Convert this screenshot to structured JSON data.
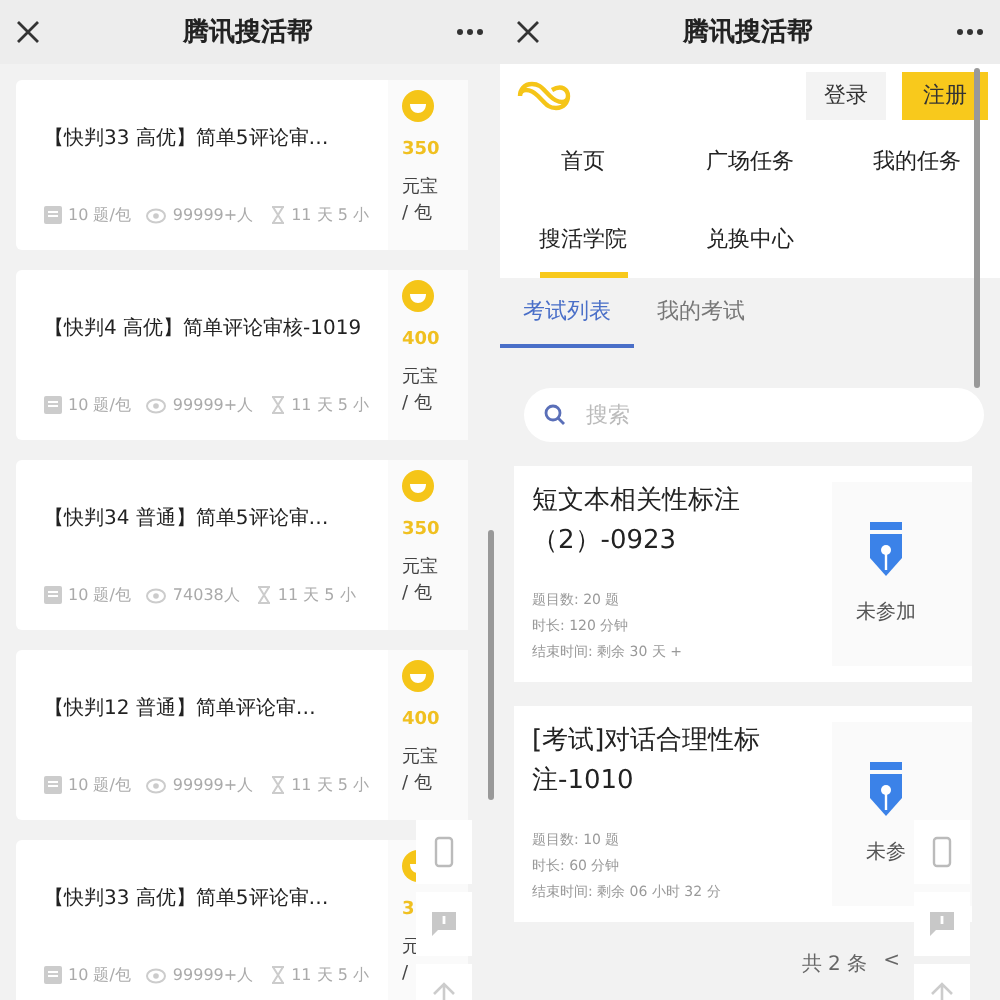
{
  "left_screen": {
    "title": "腾讯搜活帮",
    "tasks": [
      {
        "title": "【快判33 高优】简单5评论审…",
        "questions": "10 题/包",
        "participants": "99999+人",
        "time": "11 天 5 小",
        "amount": "350",
        "unit": [
          "元宝",
          "/ 包"
        ]
      },
      {
        "title": "【快判4 高优】简单评论审核-1019",
        "questions": "10 题/包",
        "participants": "99999+人",
        "time": "11 天 5 小",
        "amount": "400",
        "unit": [
          "元宝",
          "/ 包"
        ]
      },
      {
        "title": "【快判34 普通】简单5评论审…",
        "questions": "10 题/包",
        "participants": "74038人",
        "time": "11 天 5 小",
        "amount": "350",
        "unit": [
          "元宝",
          "/ 包"
        ]
      },
      {
        "title": "【快判12 普通】简单评论审…",
        "questions": "10 题/包",
        "participants": "99999+人",
        "time": "11 天 5 小",
        "amount": "400",
        "unit": [
          "元宝",
          "/ 包"
        ]
      },
      {
        "title": "【快判33 高优】简单5评论审…",
        "questions": "10 题/包",
        "participants": "99999+人",
        "time": "11 天 5 小",
        "amount": "3",
        "unit": [
          "元",
          "/"
        ]
      }
    ]
  },
  "right_screen": {
    "title": "腾讯搜活帮",
    "buttons": [
      {
        "label": "登录",
        "kind": "secondary"
      },
      {
        "label": "注册",
        "kind": "primary"
      }
    ],
    "nav": [
      {
        "label": "首页",
        "selected": false
      },
      {
        "label": "广场任务",
        "selected": false
      },
      {
        "label": "我的任务",
        "selected": false
      },
      {
        "label": "搜活学院",
        "selected": true
      },
      {
        "label": "兑换中心",
        "selected": false
      }
    ],
    "tabs": [
      {
        "label": "考试列表",
        "selected": true
      },
      {
        "label": "我的考试",
        "selected": false
      }
    ],
    "search": {
      "placeholder": "搜索"
    },
    "exams": [
      {
        "title": "短文本相关性标注（2）-0923",
        "meta": [
          "题目数: 20 题",
          "时长: 120 分钟",
          "结束时间: 剩余 30 天 +"
        ],
        "status": "未参加"
      },
      {
        "title": "[考试]对话合理性标注-1010",
        "meta": [
          "题目数: 10 题",
          "时长: 60 分钟",
          "结束时间: 剩余 06 小时 32 分"
        ],
        "status": "未参"
      }
    ],
    "pagination": {
      "total": "共 2 条",
      "prev": "<"
    }
  }
}
